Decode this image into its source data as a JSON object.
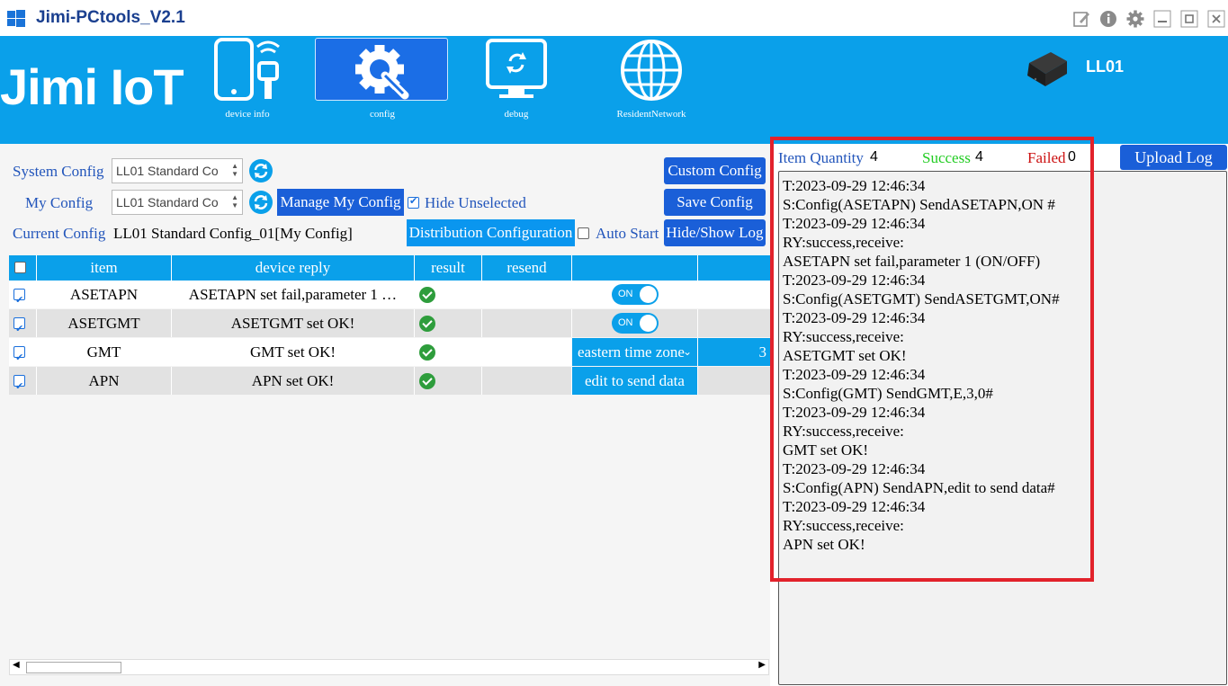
{
  "window": {
    "title": "Jimi-PCtools_V2.1",
    "icons": [
      "windows-logo-icon",
      "edit-icon",
      "info-icon",
      "settings-icon",
      "minimize-icon",
      "maximize-icon",
      "close-icon"
    ]
  },
  "banner": {
    "brand": "Jimi IoT",
    "nav": [
      {
        "label": "device info",
        "icon": "phone-device-icon",
        "active": false
      },
      {
        "label": "config",
        "icon": "gear-wrench-icon",
        "active": true
      },
      {
        "label": "debug",
        "icon": "monitor-refresh-icon",
        "active": false
      },
      {
        "label": "ResidentNetwork",
        "icon": "globe-icon",
        "active": false
      }
    ],
    "device_name": "LL01"
  },
  "config": {
    "system_config_label": "System Config",
    "system_config_value": "LL01 Standard Co",
    "my_config_label": "My Config",
    "my_config_value": "LL01 Standard Co",
    "manage_button": "Manage My Config",
    "hide_unselected_label": "Hide Unselected",
    "hide_unselected_checked": true,
    "current_config_label": "Current Config",
    "current_config_value": "LL01 Standard Config_01[My Config]",
    "distribution_button": "Distribution Configuration",
    "auto_start_label": "Auto Start",
    "auto_start_checked": false,
    "custom_config_button": "Custom Config",
    "save_config_button": "Save Config",
    "hide_show_log_button": "Hide/Show Log"
  },
  "table": {
    "headers": [
      "item",
      "device reply",
      "result",
      "resend",
      "",
      ""
    ],
    "rows": [
      {
        "checked": true,
        "item": "ASETAPN",
        "reply": "ASETAPN set fail,parameter 1 …",
        "result": "ok",
        "param": "ON",
        "extra": ""
      },
      {
        "checked": true,
        "item": "ASETGMT",
        "reply": "ASETGMT set OK!",
        "result": "ok",
        "param": "ON",
        "extra": ""
      },
      {
        "checked": true,
        "item": "GMT",
        "reply": "GMT set OK!",
        "result": "ok",
        "param": "eastern time zone",
        "extra": "3"
      },
      {
        "checked": true,
        "item": "APN",
        "reply": "APN set OK!",
        "result": "ok",
        "param": "edit to send data",
        "extra": ""
      }
    ]
  },
  "log": {
    "item_quantity_label": "Item Quantity",
    "item_quantity": "4",
    "success_label": "Success",
    "success": "4",
    "failed_label": "Failed",
    "failed": "0",
    "upload_button": "Upload Log",
    "lines": [
      "T:2023-09-29 12:46:34",
      "S:Config(ASETAPN) SendASETAPN,ON #",
      "T:2023-09-29 12:46:34",
      "RY:success,receive:",
      "ASETAPN set fail,parameter 1 (ON/OFF)",
      "T:2023-09-29 12:46:34",
      "S:Config(ASETGMT) SendASETGMT,ON#",
      "T:2023-09-29 12:46:34",
      "RY:success,receive:",
      "ASETGMT set OK!",
      "T:2023-09-29 12:46:34",
      "S:Config(GMT) SendGMT,E,3,0#",
      "T:2023-09-29 12:46:34",
      "RY:success,receive:",
      "GMT set OK!",
      "T:2023-09-29 12:46:34",
      "S:Config(APN) SendAPN,edit to send data#",
      "T:2023-09-29 12:46:34",
      "RY:success,receive:",
      "APN set OK!"
    ]
  },
  "colors": {
    "banner": "#0aa0ea",
    "button": "#1a5fd8",
    "success": "#2e9d3c",
    "highlight_frame": "#e2222b"
  }
}
